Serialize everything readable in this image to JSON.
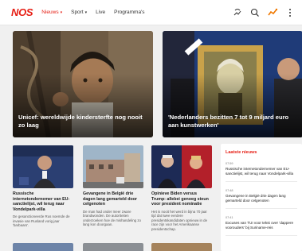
{
  "header": {
    "logo": "NOS",
    "nav": [
      {
        "label": "Nieuws",
        "active": true,
        "dropdown": true
      },
      {
        "label": "Sport",
        "active": false,
        "dropdown": true
      },
      {
        "label": "Live",
        "active": false,
        "dropdown": false
      },
      {
        "label": "Programma's",
        "active": false,
        "dropdown": false
      }
    ],
    "tools": [
      "accessibility-icon",
      "search-icon",
      "trending-icon",
      "more-vertical-icon"
    ]
  },
  "colors": {
    "brand": "#e61e14",
    "background": "#f0f0f0"
  },
  "heroes": [
    {
      "title": "Unicef: wereldwijde kindersterfte nog nooit zo laag"
    },
    {
      "title": "'Nederlanders bezitten 7 tot 9 miljard euro aan kunstwerken'"
    }
  ],
  "cards": [
    {
      "title": "Russische internetondernemer van EU-sanctielijst, wil terug naar Vondelpark-villa",
      "desc": "De gesanctioneerde Rus noemde de invasie van Rusland vorig jaar 'barbaars'."
    },
    {
      "title": "Gevangene in België drie dagen lang gemarteld door celgenoten",
      "desc": "De man had onder meer zware brandwonden. De autoriteiten onderzoeken hoe de mishandeling zo lang kon doorgaan."
    },
    {
      "title": "Opinieve Biden versus Trump: allebei genoeg steun voor president nominatie",
      "desc": "Het is nooit het werd in bijna 70 jaar tijd dat twee eerdere presidentskandidaten opnieuw in de race zijn voor het Amerikaanse presidentschap."
    }
  ],
  "latest": {
    "heading": "Laatste nieuws",
    "items": [
      {
        "time": "07:59",
        "title": "Russische internetondernemer van EU-sanctielijst, wil terug naar Vondelpark-villa"
      },
      {
        "time": "07:48",
        "title": "Gevangene in België drie dagen lang gemarteld door celgenoten"
      },
      {
        "time": "07:41",
        "title": "Excuses van TUI voor tekst over 'dappere voorouders' bij Suriname-reis"
      }
    ]
  }
}
